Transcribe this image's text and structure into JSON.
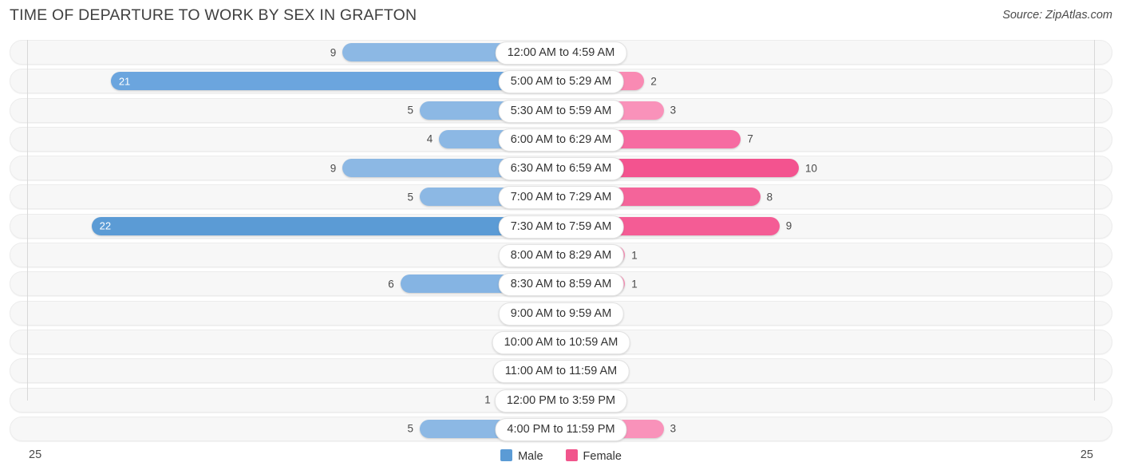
{
  "header": {
    "title": "TIME OF DEPARTURE TO WORK BY SEX IN GRAFTON",
    "source": "Source: ZipAtlas.com"
  },
  "axis": {
    "left_label": "25",
    "right_label": "25",
    "max": 25
  },
  "legend": {
    "items": [
      {
        "label": "Male",
        "color": "#5b9bd5"
      },
      {
        "label": "Female",
        "color": "#f1558c"
      }
    ]
  },
  "colors": {
    "male_light": "#8cb8e4",
    "male_mid": "#7fb2e5",
    "male_strong": "#5b9bd5",
    "female_light": "#f9a3c0",
    "female_mid": "#f77ca8",
    "female_strong": "#f4649a",
    "female_deep": "#f1558c"
  },
  "chart_data": {
    "type": "bar",
    "orientation": "horizontal-diverging",
    "title": "TIME OF DEPARTURE TO WORK BY SEX IN GRAFTON",
    "xlabel": "",
    "ylabel": "",
    "xlim": [
      25,
      25
    ],
    "grid": false,
    "legend_position": "bottom-center",
    "categories": [
      "12:00 AM to 4:59 AM",
      "5:00 AM to 5:29 AM",
      "5:30 AM to 5:59 AM",
      "6:00 AM to 6:29 AM",
      "6:30 AM to 6:59 AM",
      "7:00 AM to 7:29 AM",
      "7:30 AM to 7:59 AM",
      "8:00 AM to 8:29 AM",
      "8:30 AM to 8:59 AM",
      "9:00 AM to 9:59 AM",
      "10:00 AM to 10:59 AM",
      "11:00 AM to 11:59 AM",
      "12:00 PM to 3:59 PM",
      "4:00 PM to 11:59 PM"
    ],
    "series": [
      {
        "name": "Male",
        "values": [
          9,
          21,
          5,
          4,
          9,
          5,
          22,
          0,
          6,
          0,
          0,
          0,
          1,
          5
        ]
      },
      {
        "name": "Female",
        "values": [
          0,
          2,
          3,
          7,
          10,
          8,
          9,
          1,
          1,
          0,
          0,
          0,
          0,
          3
        ]
      }
    ]
  },
  "rows": [
    {
      "category": "12:00 AM to 4:59 AM",
      "male": "9",
      "female": "0",
      "male_v": 9,
      "female_v": 0,
      "male_color": "#8cb8e4",
      "female_color": "#f9a3c0",
      "male_inside": false
    },
    {
      "category": "5:00 AM to 5:29 AM",
      "male": "21",
      "female": "2",
      "male_v": 21,
      "female_v": 2,
      "male_color": "#6ba5de",
      "female_color": "#f98ab3",
      "male_inside": true
    },
    {
      "category": "5:30 AM to 5:59 AM",
      "male": "5",
      "female": "3",
      "male_v": 5,
      "female_v": 3,
      "male_color": "#8cb8e4",
      "female_color": "#f992ba",
      "male_inside": false
    },
    {
      "category": "6:00 AM to 6:29 AM",
      "male": "4",
      "female": "7",
      "male_v": 4,
      "female_v": 7,
      "male_color": "#8cb8e4",
      "female_color": "#f66ba1",
      "male_inside": false
    },
    {
      "category": "6:30 AM to 6:59 AM",
      "male": "9",
      "female": "10",
      "male_v": 9,
      "female_v": 10,
      "male_color": "#8cb8e4",
      "female_color": "#f3538f",
      "male_inside": false
    },
    {
      "category": "7:00 AM to 7:29 AM",
      "male": "5",
      "female": "8",
      "male_v": 5,
      "female_v": 8,
      "male_color": "#8cb8e4",
      "female_color": "#f4649a",
      "male_inside": false
    },
    {
      "category": "7:30 AM to 7:59 AM",
      "male": "22",
      "female": "9",
      "male_v": 22,
      "female_v": 9,
      "male_color": "#5b9bd5",
      "female_color": "#f45c95",
      "male_inside": true
    },
    {
      "category": "8:00 AM to 8:29 AM",
      "male": "0",
      "female": "1",
      "male_v": 0,
      "female_v": 1,
      "male_color": "#a7c9ec",
      "female_color": "#f98ab3",
      "male_inside": false
    },
    {
      "category": "8:30 AM to 8:59 AM",
      "male": "6",
      "female": "1",
      "male_v": 6,
      "female_v": 1,
      "male_color": "#85b4e3",
      "female_color": "#f98ab3",
      "male_inside": false
    },
    {
      "category": "9:00 AM to 9:59 AM",
      "male": "0",
      "female": "0",
      "male_v": 0,
      "female_v": 0,
      "male_color": "#a7c9ec",
      "female_color": "#f9a3c0",
      "male_inside": false
    },
    {
      "category": "10:00 AM to 10:59 AM",
      "male": "0",
      "female": "0",
      "male_v": 0,
      "female_v": 0,
      "male_color": "#a7c9ec",
      "female_color": "#f9a3c0",
      "male_inside": false
    },
    {
      "category": "11:00 AM to 11:59 AM",
      "male": "0",
      "female": "0",
      "male_v": 0,
      "female_v": 0,
      "male_color": "#a7c9ec",
      "female_color": "#f9a3c0",
      "male_inside": false
    },
    {
      "category": "12:00 PM to 3:59 PM",
      "male": "1",
      "female": "0",
      "male_v": 1,
      "female_v": 0,
      "male_color": "#9cc2e9",
      "female_color": "#f9a3c0",
      "male_inside": false
    },
    {
      "category": "4:00 PM to 11:59 PM",
      "male": "5",
      "female": "3",
      "male_v": 5,
      "female_v": 3,
      "male_color": "#8cb8e4",
      "female_color": "#f992ba",
      "male_inside": false
    }
  ]
}
